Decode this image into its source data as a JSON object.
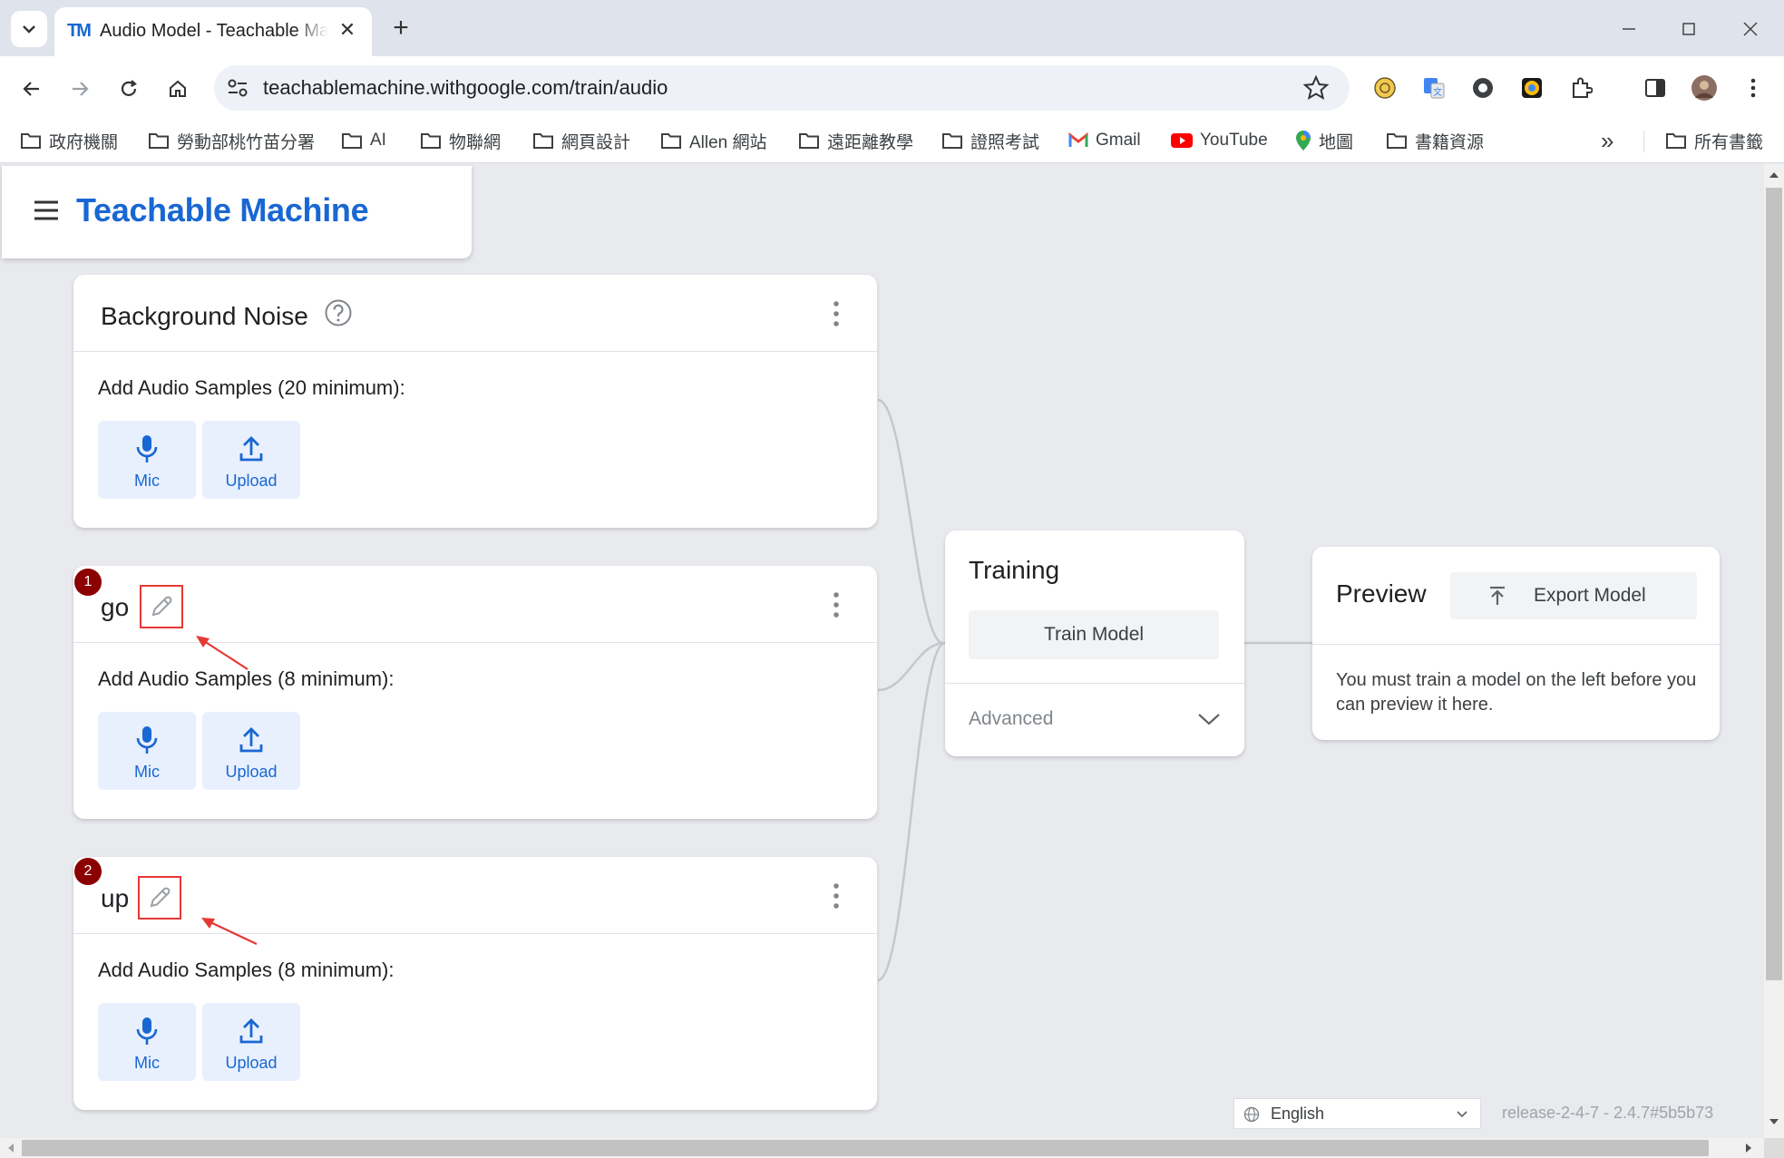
{
  "browser": {
    "tab_title": "Audio Model - Teachable Machine",
    "favicon_text": "TM",
    "url": "teachablemachine.withgoogle.com/train/audio",
    "tab_close_glyph": "✕",
    "new_tab_glyph": "+",
    "overflow_glyph": "»",
    "bookmarks": [
      {
        "label": "政府機關",
        "icon": "folder-icon"
      },
      {
        "label": "勞動部桃竹苗分署",
        "icon": "folder-icon"
      },
      {
        "label": "AI",
        "icon": "folder-icon"
      },
      {
        "label": "物聯網",
        "icon": "folder-icon"
      },
      {
        "label": "網頁設計",
        "icon": "folder-icon"
      },
      {
        "label": "Allen 網站",
        "icon": "folder-icon"
      },
      {
        "label": "遠距離教學",
        "icon": "folder-icon"
      },
      {
        "label": "證照考試",
        "icon": "folder-icon"
      },
      {
        "label": "Gmail",
        "icon": "gmail-icon"
      },
      {
        "label": "YouTube",
        "icon": "youtube-icon"
      },
      {
        "label": "地圖",
        "icon": "maps-icon"
      },
      {
        "label": "書籍資源",
        "icon": "folder-icon"
      },
      {
        "label": "所有書籤",
        "icon": "folder-icon"
      }
    ]
  },
  "app": {
    "title": "Teachable Machine",
    "classes": [
      {
        "name": "Background Noise",
        "samples_label": "Add Audio Samples (20 minimum):",
        "mic_label": "Mic",
        "upload_label": "Upload"
      },
      {
        "name": "go",
        "samples_label": "Add Audio Samples (8 minimum):",
        "mic_label": "Mic",
        "upload_label": "Upload",
        "badge": "1"
      },
      {
        "name": "up",
        "samples_label": "Add Audio Samples (8 minimum):",
        "mic_label": "Mic",
        "upload_label": "Upload",
        "badge": "2"
      }
    ],
    "training": {
      "title": "Training",
      "train_button": "Train Model",
      "advanced_label": "Advanced"
    },
    "preview": {
      "title": "Preview",
      "export_button": "Export Model",
      "message": "You must train a model on the left before you can preview it here."
    },
    "footer": {
      "language": "English",
      "release": "release-2-4-7 - 2.4.7#5b5b73"
    }
  },
  "colors": {
    "brand_blue": "#1967d2",
    "sample_button_bg": "#e8f0fe",
    "annotation_red": "#e53935",
    "badge_red": "#8b0000"
  }
}
